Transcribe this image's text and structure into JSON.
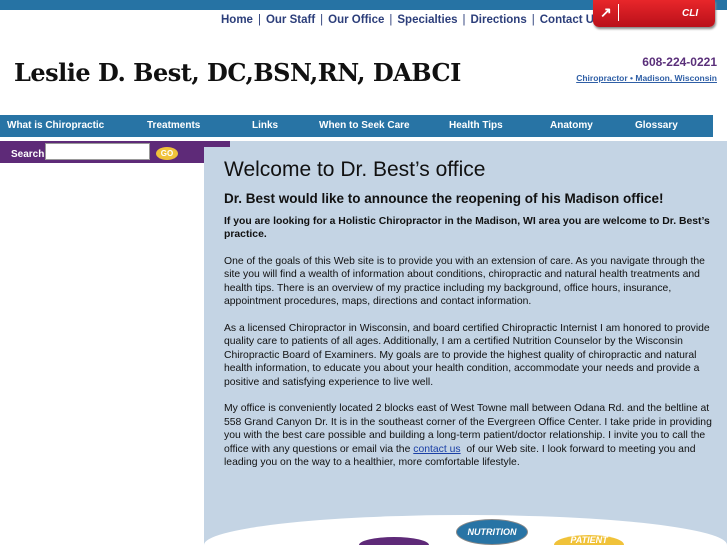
{
  "top_links": [
    "Home",
    "Our Staff",
    "Our Office",
    "Specialties",
    "Directions",
    "Contact Us"
  ],
  "cli_label": "CLI",
  "site_title": "Leslie D. Best, DC,BSN,RN, DABCI",
  "phone": "608-224-0221",
  "tagline": "Chiropractor • Madison, Wisconsin",
  "nav": [
    "What is Chiropractic",
    "Treatments",
    "Links",
    "When to Seek Care",
    "Health Tips",
    "Anatomy",
    "Glossary"
  ],
  "search": {
    "label": "Search",
    "value": "",
    "go": "GO"
  },
  "main": {
    "heading": "Welcome to Dr. Best’s office",
    "subheading": "Dr. Best would like to announce the reopening of his Madison office!",
    "intro": "If you are looking for a Holistic Chiropractor in the Madison, WI area you are welcome to Dr. Best’s practice.",
    "p1": "One of the goals of this Web site is to provide you with an extension of care. As you navigate through the site you will find a wealth of information about conditions, chiropractic and natural health treatments and health tips. There is an overview of my practice including my background, office hours, insurance, appointment procedures, maps, directions and contact information.",
    "p2": "As a licensed Chiropractor in Wisconsin, and board certified Chiropractic Internist I am honored to provide quality care to patients of all ages. Additionally, I am a certified Nutrition Counselor by the Wisconsin Chiropractic Board of Examiners. My goals are to provide the highest quality of chiropractic and natural health information, to educate you about your health condition, accommodate your needs and provide a positive and satisfying experience to live well.",
    "p3_before": "My office is conveniently located 2 blocks east of West Towne mall between Odana Rd. and the beltline at 558 Grand Canyon Dr. It is in the southeast corner of the Evergreen Office Center. I take pride in providing you with the best care possible and building a long-term patient/doctor relationship. I invite you to call the office with any questions or email via the ",
    "p3_link": "contact us",
    "p3_after": "  of our Web site. I look forward to meeting you and leading you on the way to a healthier, more comfortable lifestyle."
  },
  "badges": {
    "nutrition": "NUTRITION",
    "patient": "PATIENT"
  }
}
